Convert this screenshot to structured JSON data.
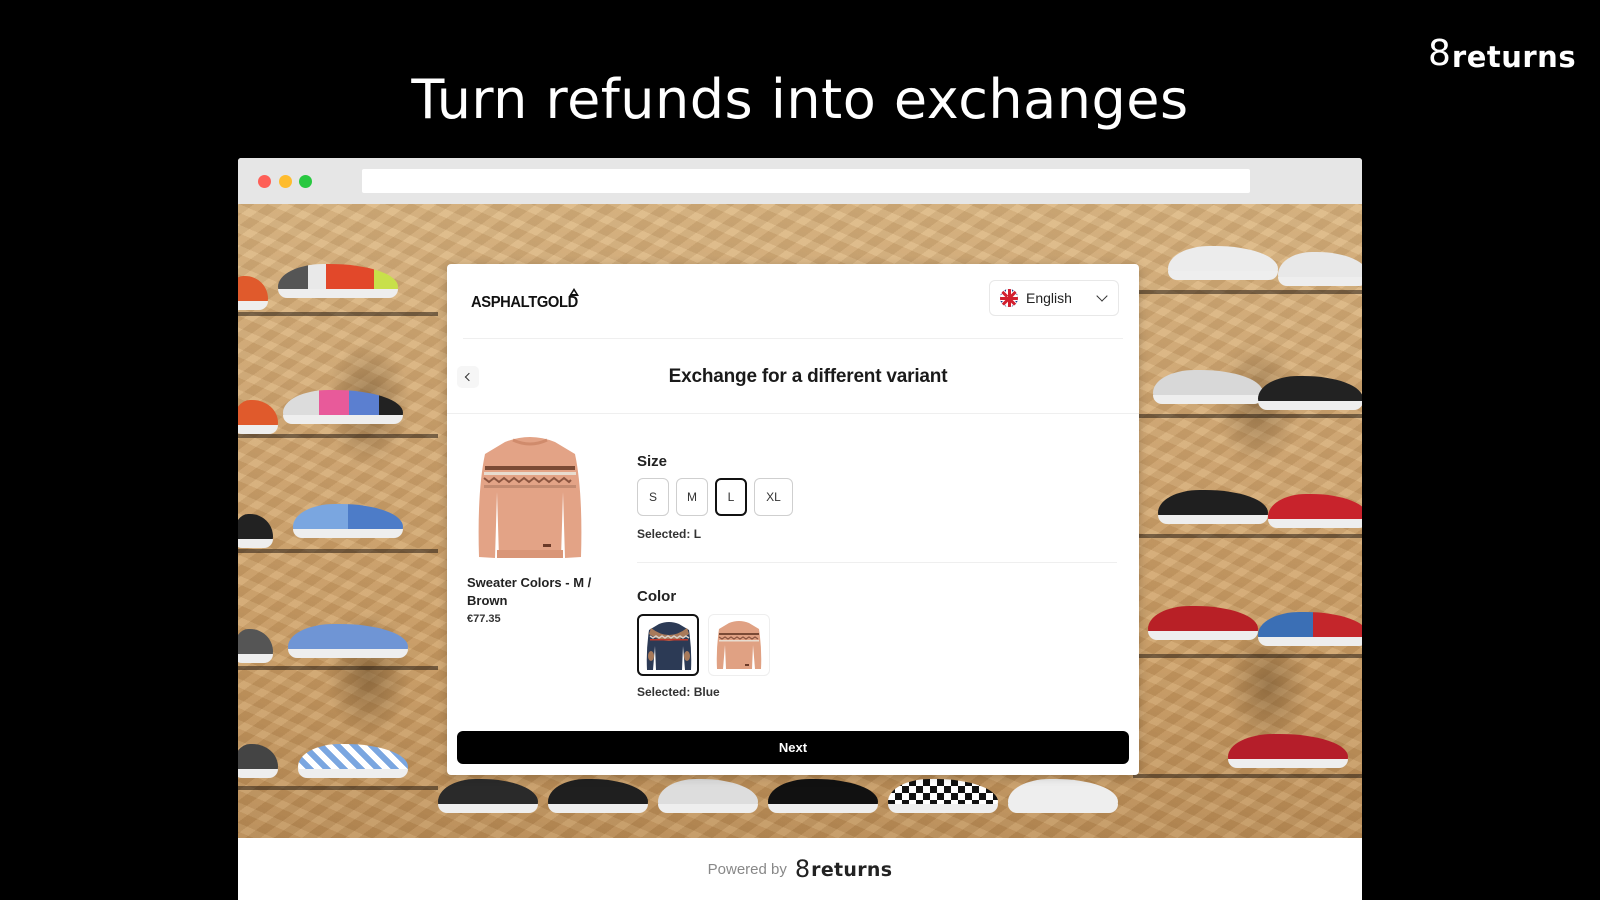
{
  "brand": {
    "logo_digit": "8",
    "logo_word": "returns"
  },
  "headline": "Turn refunds into exchanges",
  "browser": {
    "url": ""
  },
  "modal": {
    "store_logo": "ASPHALTGOLD",
    "language": {
      "selected": "English",
      "flag_icon": "uk-flag-icon"
    },
    "title": "Exchange for a different variant",
    "product": {
      "name": "Sweater Colors - M / Brown",
      "price": "€77.35",
      "image_icon": "sweater-image"
    },
    "size": {
      "label": "Size",
      "options": [
        "S",
        "M",
        "L",
        "XL"
      ],
      "selected": "L",
      "selected_text": "Selected: L"
    },
    "color": {
      "label": "Color",
      "options": [
        {
          "name": "Blue",
          "swatch_color": "#2c3a55"
        },
        {
          "name": "Brown",
          "swatch_color": "#e0a183"
        }
      ],
      "selected": "Blue",
      "selected_text": "Selected: Blue"
    },
    "next_label": "Next"
  },
  "footer": {
    "powered_by": "Powered by",
    "logo_digit": "8",
    "logo_word": "returns"
  },
  "colors": {
    "background": "#000000",
    "primary_button": "#000000",
    "traffic_red": "#fe5f57",
    "traffic_yellow": "#febc2e",
    "traffic_green": "#28c840"
  }
}
